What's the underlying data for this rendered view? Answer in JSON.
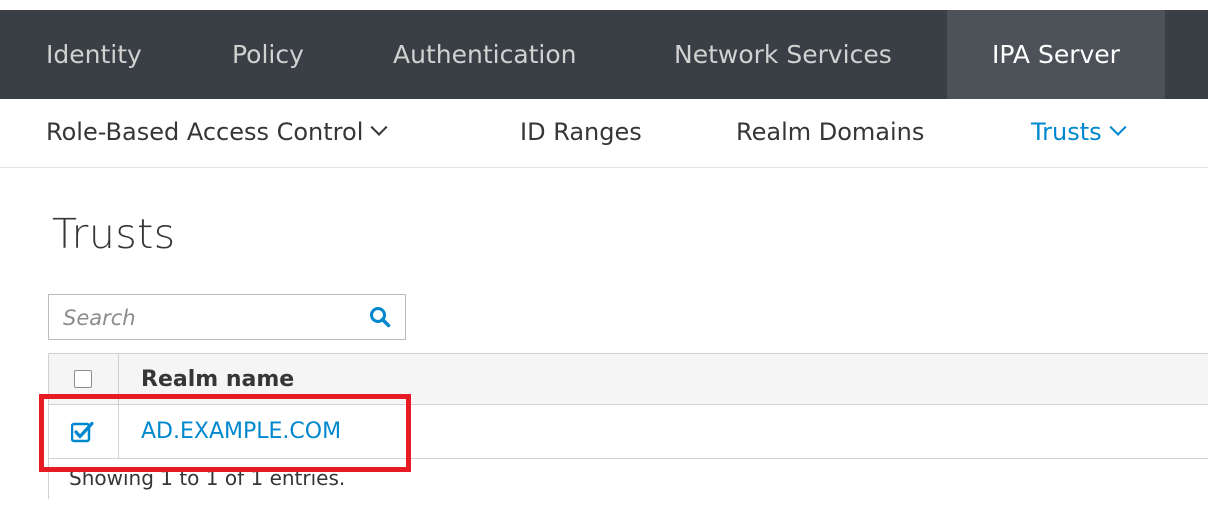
{
  "topnav": {
    "items": [
      {
        "label": "Identity"
      },
      {
        "label": "Policy"
      },
      {
        "label": "Authentication"
      },
      {
        "label": "Network Services"
      },
      {
        "label": "IPA Server",
        "active": true
      }
    ]
  },
  "subnav": {
    "items": [
      {
        "label": "Role-Based Access Control"
      },
      {
        "label": "ID Ranges"
      },
      {
        "label": "Realm Domains"
      },
      {
        "label": "Trusts",
        "active": true
      }
    ]
  },
  "page": {
    "title": "Trusts"
  },
  "search": {
    "placeholder": "Search",
    "value": ""
  },
  "table": {
    "columns": [
      "Realm name"
    ],
    "rows": [
      {
        "realm_name": "AD.EXAMPLE.COM",
        "checked": true
      }
    ],
    "footer": "Showing 1 to 1 of 1 entries."
  },
  "colors": {
    "topnav_bg": "#393f44",
    "active_tab_bg": "#4d5258",
    "accent": "#0088ce",
    "highlight": "#e61b23"
  },
  "icons": {
    "search": "search-icon",
    "checked": "checkbox-checked-icon",
    "dropdown": "chevron-down-icon"
  }
}
